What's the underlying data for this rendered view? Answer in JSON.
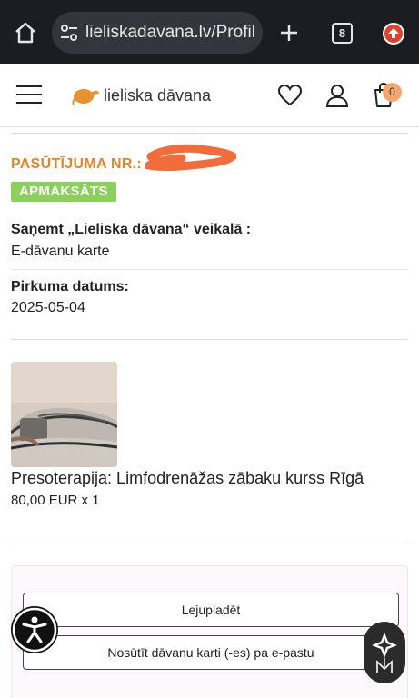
{
  "browser": {
    "url": "lieliskadavana.lv/Profil",
    "tab_count": "8"
  },
  "header": {
    "logo_text": "lieliska dāvana",
    "cart_count": "0"
  },
  "order": {
    "number_label": "PASŪTĪJUMA NR.:",
    "status": "APMAKSĀTS",
    "pickup_label": "Saņemt „Lieliska dāvana“ veikalā :",
    "pickup_value": "E-dāvanu karte",
    "date_label": "Pirkuma datums:",
    "date_value": "2025-05-04"
  },
  "product": {
    "name": "Presoterapija: Limfodrenāžas zābaku kurss Rīgā",
    "price": "80,00 EUR x 1"
  },
  "actions": {
    "download_label": "Lejupladēt",
    "email_label": "Nosūtīt dāvanu karti (-es) pa e-pastu"
  },
  "colors": {
    "accent_orange": "#e2862a",
    "status_green": "#8bcf5c",
    "browser_bg": "#1b1d22",
    "cart_badge": "#f6a86a"
  },
  "icons": [
    "home-icon",
    "tune-icon",
    "plus-icon",
    "tabs-icon",
    "profile-icon",
    "menu-icon",
    "logo-icon",
    "heart-icon",
    "user-icon",
    "cart-icon",
    "accessibility-icon",
    "chat-icon"
  ]
}
